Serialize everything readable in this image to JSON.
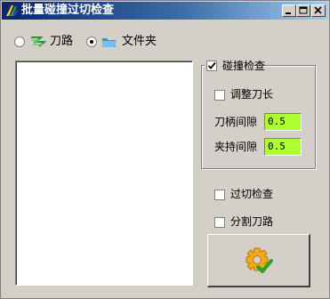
{
  "window": {
    "title": "批量碰撞过切检查"
  },
  "mode": {
    "options": [
      {
        "label": "刀路",
        "icon": "toolpath-icon",
        "selected": false
      },
      {
        "label": "文件夹",
        "icon": "folder-icon",
        "selected": true
      }
    ]
  },
  "collision": {
    "title": "碰撞检查",
    "checked": true,
    "adjust_tool_length": {
      "label": "调整刀长",
      "checked": false
    },
    "holder_gap": {
      "label": "刀柄间隙",
      "value": "0.5"
    },
    "clamp_gap": {
      "label": "夹持间隙",
      "value": "0.5"
    }
  },
  "gouge_check": {
    "label": "过切检查",
    "checked": false
  },
  "split_toolpath": {
    "label": "分割刀路",
    "checked": false
  },
  "run_button": {
    "icon": "gear-check-icon"
  },
  "colors": {
    "edit_background": "#adff2f",
    "titlebar_start": "#0a246a",
    "titlebar_end": "#a6caf0"
  }
}
